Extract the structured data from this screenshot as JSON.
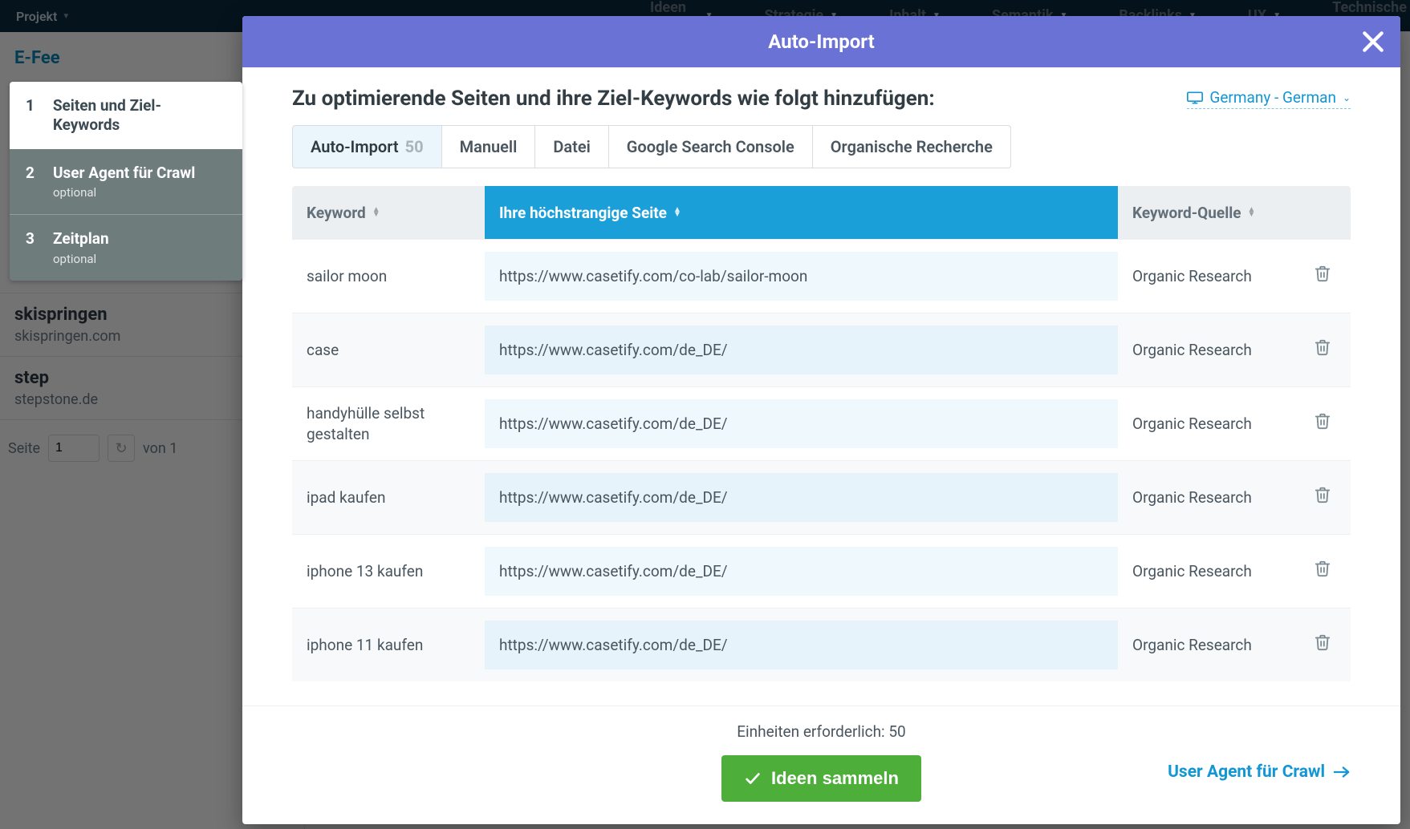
{
  "bg": {
    "projekt_label": "Projekt",
    "subnav": [
      "Ideen gesamt",
      "Strategie",
      "Inhalt",
      "Semantik",
      "Backlinks",
      "UX",
      "Technische Pr"
    ],
    "efee": "E-Fee",
    "projects": [
      {
        "name": "skispringen",
        "domain": "skispringen.com"
      },
      {
        "name": "step",
        "domain": "stepstone.de"
      }
    ],
    "pager_seite": "Seite",
    "pager_page": "1",
    "pager_von": "von  1"
  },
  "steps": [
    {
      "num": "1",
      "label": "Seiten und Ziel-Keywords"
    },
    {
      "num": "2",
      "label": "User Agent für Crawl",
      "optional": "optional"
    },
    {
      "num": "3",
      "label": "Zeitplan",
      "optional": "optional"
    }
  ],
  "modal": {
    "title": "Auto-Import",
    "heading": "Zu optimierende Seiten und ihre Ziel-Keywords wie folgt hinzufügen:",
    "region": "Germany - German",
    "tabs": [
      {
        "label": "Auto-Import",
        "count": "50",
        "active": true
      },
      {
        "label": "Manuell"
      },
      {
        "label": "Datei"
      },
      {
        "label": "Google Search Console"
      },
      {
        "label": "Organische Recherche"
      }
    ],
    "columns": {
      "kw": "Keyword",
      "page": "Ihre höchstrangige Seite",
      "src": "Keyword-Quelle"
    },
    "rows": [
      {
        "kw": "sailor moon",
        "page": "https://www.casetify.com/co-lab/sailor-moon",
        "src": "Organic Research"
      },
      {
        "kw": "case",
        "page": "https://www.casetify.com/de_DE/",
        "src": "Organic Research"
      },
      {
        "kw": "handyhülle selbst gestalten",
        "page": "https://www.casetify.com/de_DE/",
        "src": "Organic Research"
      },
      {
        "kw": "ipad kaufen",
        "page": "https://www.casetify.com/de_DE/",
        "src": "Organic Research"
      },
      {
        "kw": "iphone 13 kaufen",
        "page": "https://www.casetify.com/de_DE/",
        "src": "Organic Research"
      },
      {
        "kw": "iphone 11 kaufen",
        "page": "https://www.casetify.com/de_DE/",
        "src": "Organic Research"
      }
    ],
    "units_label": "Einheiten erforderlich: 50",
    "cta": "Ideen sammeln",
    "next": "User Agent für Crawl"
  }
}
